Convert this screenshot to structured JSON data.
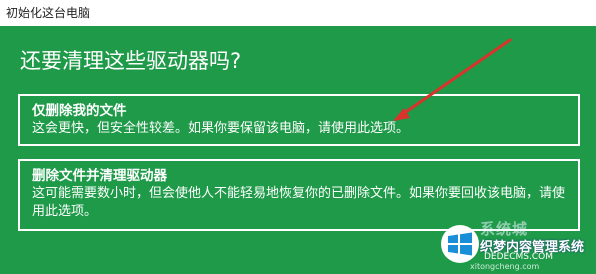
{
  "window": {
    "title": "初始化这台电脑"
  },
  "main": {
    "heading": "还要清理这些驱动器吗?",
    "options": [
      {
        "title": "仅删除我的文件",
        "description": "这会更快，但安全性较差。如果你要保留该电脑，请使用此选项。"
      },
      {
        "title": "删除文件并清理驱动器",
        "description": "这可能需要数小时，但会使他人不能轻易地恢复你的已删除文件。如果你要回收该电脑，请使用此选项。"
      }
    ]
  },
  "watermark": {
    "site_name": "系统城",
    "cn_text": "织梦内容管理系统",
    "url": "DEDECMS.COM",
    "url2": "xitongcheng.com"
  },
  "colors": {
    "background": "#1e9a49",
    "arrow": "#d9342b"
  }
}
